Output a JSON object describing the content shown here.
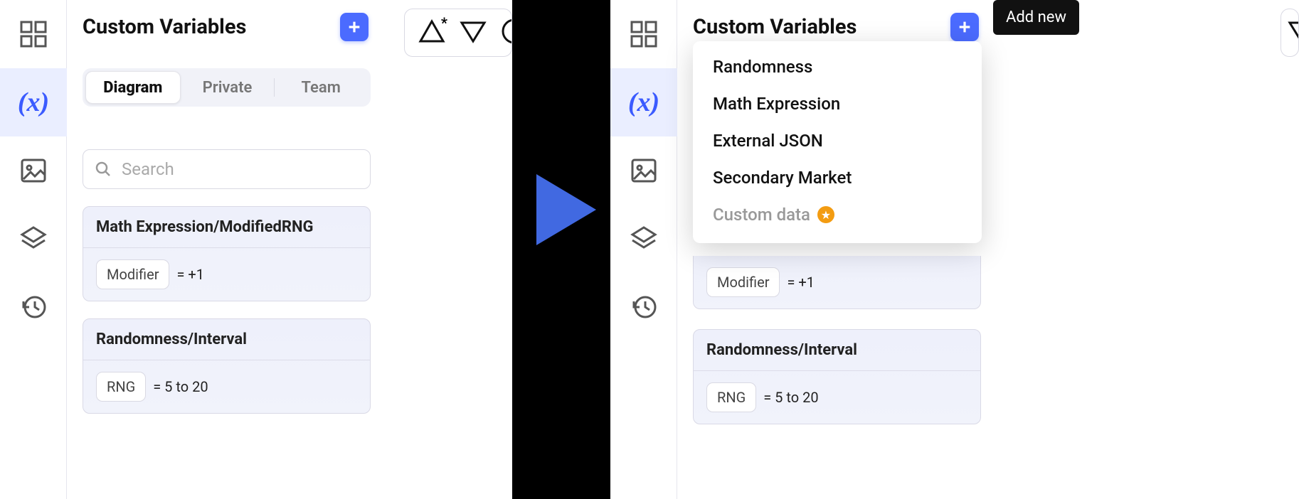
{
  "panel": {
    "title": "Custom Variables",
    "tabs": {
      "diagram": "Diagram",
      "private": "Private",
      "team": "Team"
    },
    "search_placeholder": "Search"
  },
  "vars": {
    "mathexpr": {
      "title": "Math Expression/ModifiedRNG",
      "chip": "Modifier",
      "value": "= +1"
    },
    "interval": {
      "title": "Randomness/Interval",
      "chip": "RNG",
      "value": "= 5 to 20"
    }
  },
  "dropdown": {
    "randomness": "Randomness",
    "mathexpr": "Math Expression",
    "extjson": "External JSON",
    "secondary": "Secondary Market",
    "custom": "Custom data"
  },
  "tooltip": {
    "add_new": "Add new"
  }
}
